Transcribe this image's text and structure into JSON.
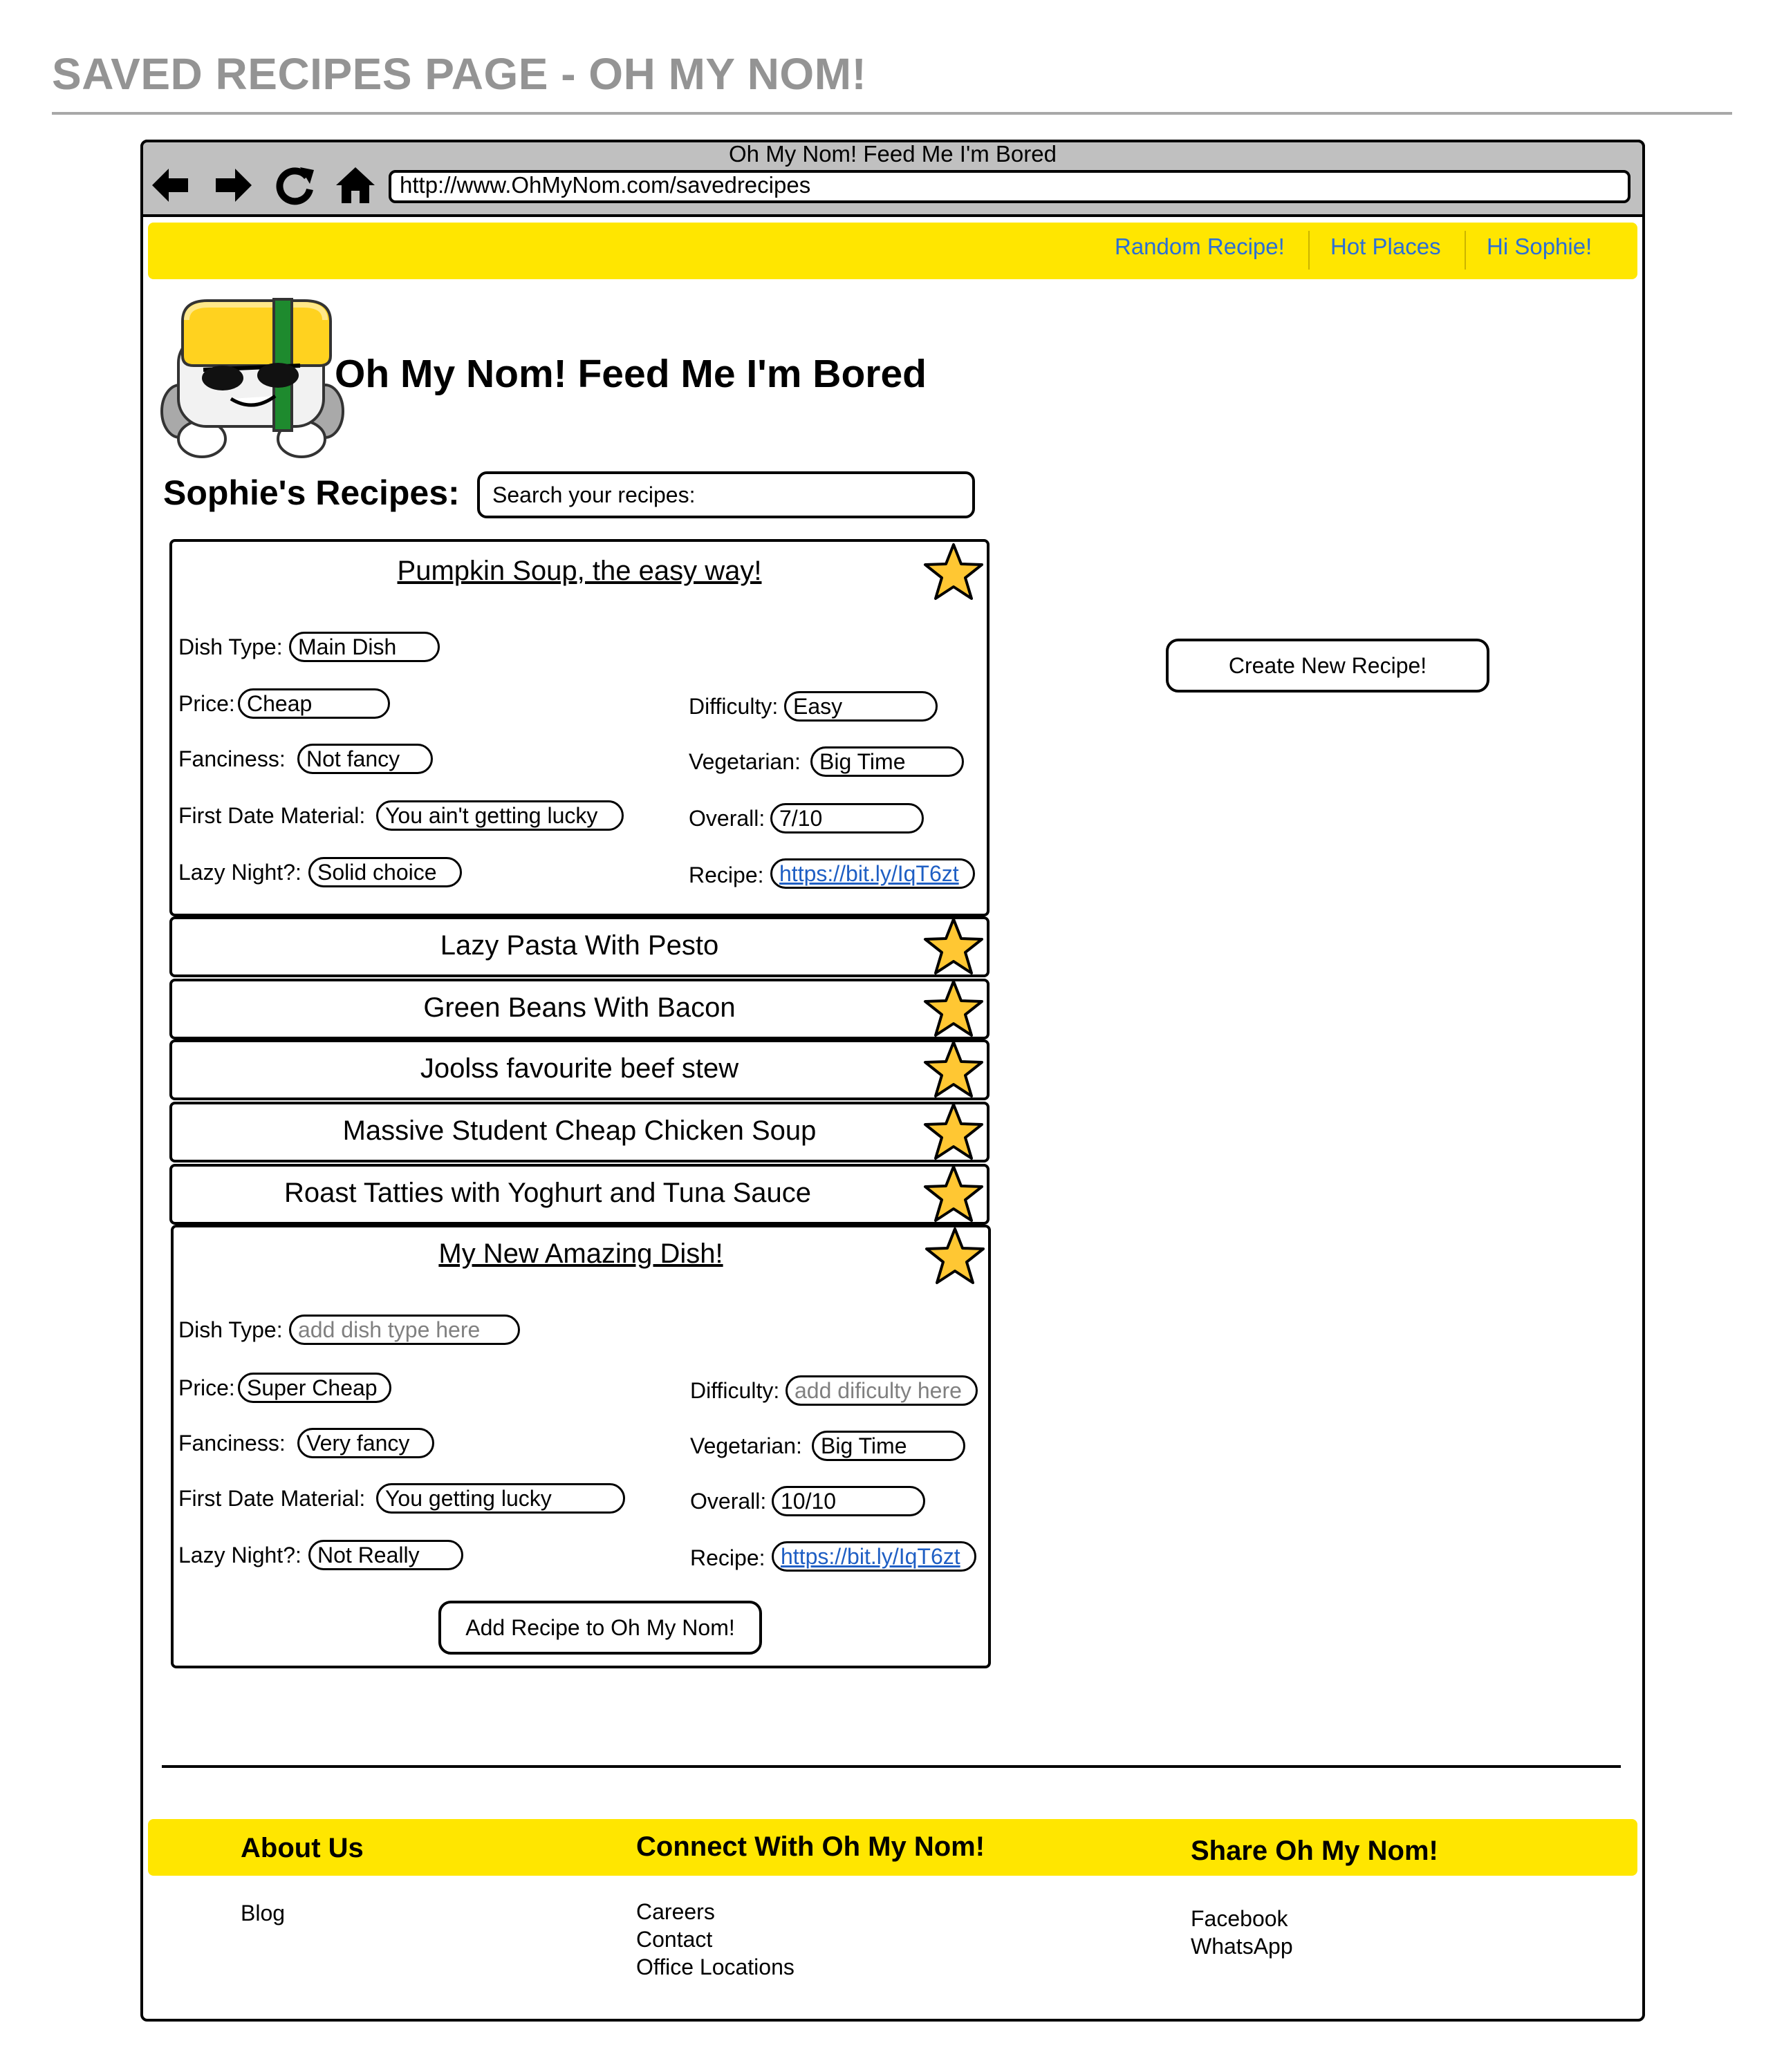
{
  "page_heading": "SAVED RECIPES PAGE - OH MY NOM!",
  "browser": {
    "window_title": "Oh My Nom! Feed Me I'm Bored",
    "url": "http://www.OhMyNom.com/savedrecipes",
    "nav_icons": [
      "back-arrow-icon",
      "forward-arrow-icon",
      "reload-icon",
      "home-icon"
    ]
  },
  "top_nav": {
    "links": [
      "Random Recipe!",
      "Hot Places",
      "Hi Sophie!"
    ]
  },
  "site": {
    "title": "Oh My Nom! Feed Me I'm Bored"
  },
  "recipes_section": {
    "heading": "Sophie's Recipes:",
    "search_placeholder": "Search your recipes:"
  },
  "expanded_recipe": {
    "title": "Pumpkin Soup, the easy way!",
    "fields": {
      "dish_type": {
        "label": "Dish Type:",
        "value": "Main Dish"
      },
      "price": {
        "label": "Price:",
        "value": "Cheap"
      },
      "fanciness": {
        "label": "Fanciness:",
        "value": "Not fancy"
      },
      "first_date": {
        "label": "First Date Material:",
        "value": "You ain't getting lucky"
      },
      "lazy_night": {
        "label": "Lazy Night?:",
        "value": "Solid choice"
      },
      "difficulty": {
        "label": "Difficulty:",
        "value": "Easy"
      },
      "vegetarian": {
        "label": "Vegetarian:",
        "value": "Big Time"
      },
      "overall": {
        "label": "Overall:",
        "value": "7/10"
      },
      "recipe": {
        "label": "Recipe:",
        "value": "https://bit.ly/IqT6zt"
      }
    }
  },
  "collapsed_recipes": [
    "Lazy Pasta With Pesto",
    "Green Beans With Bacon",
    "Joolss favourite beef stew",
    "Massive Student Cheap Chicken Soup",
    "Roast Tatties with Yoghurt and Tuna Sauce"
  ],
  "new_recipe": {
    "title": "My New Amazing Dish!",
    "fields": {
      "dish_type": {
        "label": "Dish Type:",
        "placeholder": "add dish type here"
      },
      "price": {
        "label": "Price:",
        "value": "Super Cheap"
      },
      "fanciness": {
        "label": "Fanciness:",
        "value": "Very fancy"
      },
      "first_date": {
        "label": "First Date Material:",
        "value": "You getting lucky"
      },
      "lazy_night": {
        "label": "Lazy Night?:",
        "value": "Not Really"
      },
      "difficulty": {
        "label": "Difficulty:",
        "placeholder": "add dificulty here"
      },
      "vegetarian": {
        "label": "Vegetarian:",
        "value": "Big Time"
      },
      "overall": {
        "label": "Overall:",
        "value": "10/10"
      },
      "recipe": {
        "label": "Recipe:",
        "value": "https://bit.ly/IqT6zt"
      }
    },
    "submit_label": "Add Recipe to Oh My Nom!"
  },
  "create_button_label": "Create New Recipe!",
  "footer": {
    "about": {
      "heading": "About Us",
      "links": [
        "Blog"
      ]
    },
    "connect": {
      "heading": "Connect With Oh My Nom!",
      "links": [
        "Careers",
        "Contact",
        "Office Locations"
      ]
    },
    "share": {
      "heading": "Share Oh My Nom!",
      "links": [
        "Facebook",
        "WhatsApp"
      ]
    }
  },
  "colors": {
    "nav_yellow": "#ffe600",
    "link_blue": "#2b6fd6",
    "star_fill": "#ffc733",
    "heading_gray": "#949494",
    "browser_chrome": "#c0c0c0"
  }
}
